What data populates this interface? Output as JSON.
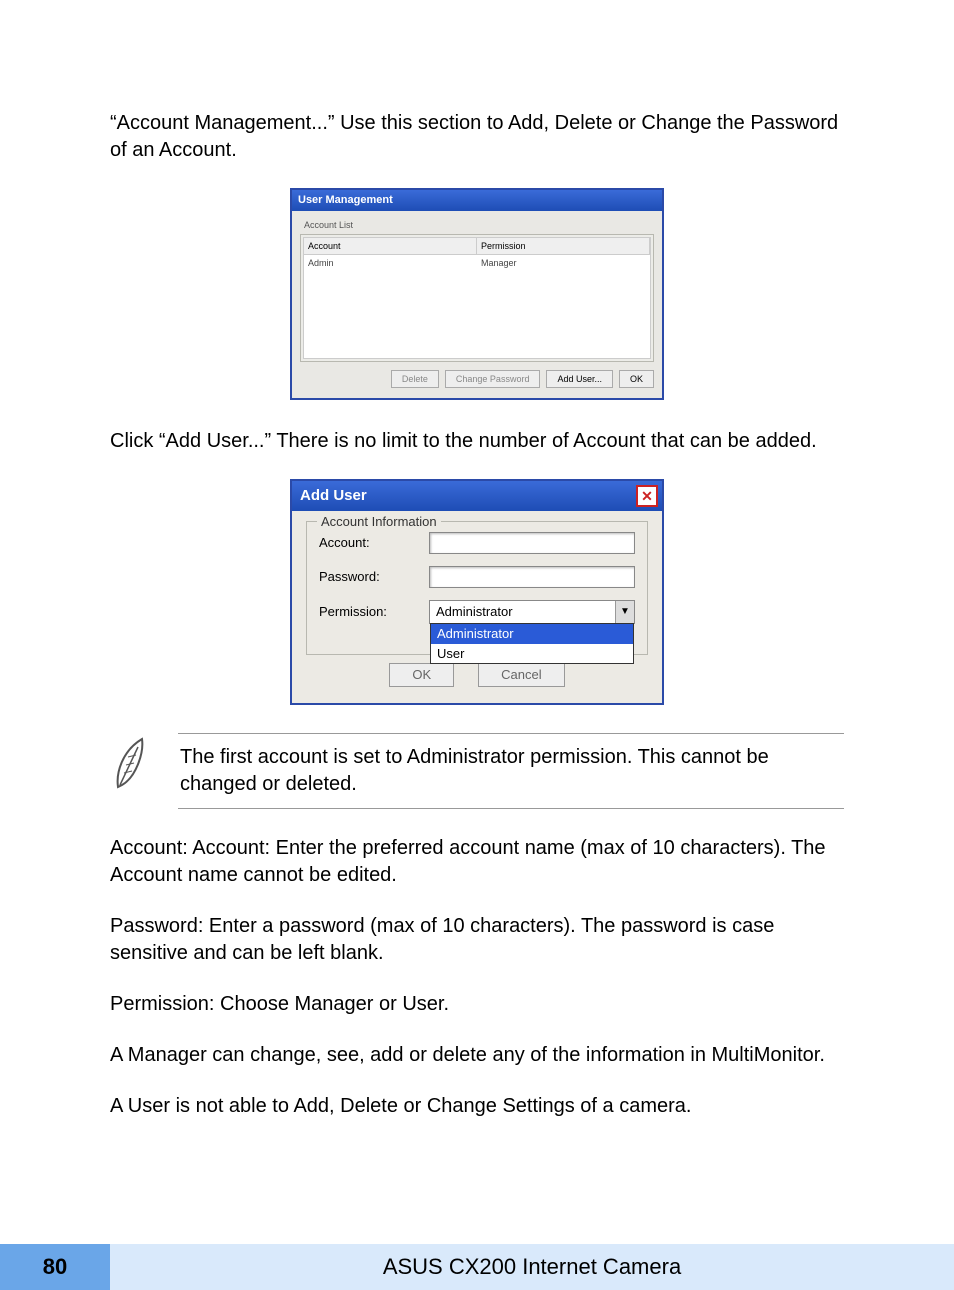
{
  "intro_para": "“Account Management...”  Use this section to Add, Delete or Change the Password of an Account.",
  "screenshot1": {
    "title": "User Management",
    "group_label": "Account List",
    "col1": "Account",
    "col2": "Permission",
    "row_account": "Admin",
    "row_permission": "Manager",
    "btn_delete": "Delete",
    "btn_change": "Change Password",
    "btn_add": "Add User...",
    "btn_ok": "OK"
  },
  "para2": "Click “Add User...”  There is no limit to the number of Account that can be added.",
  "screenshot2": {
    "title": "Add User",
    "group_label": "Account Information",
    "label_account": "Account:",
    "label_password": "Password:",
    "label_permission": "Permission:",
    "perm_selected": "Administrator",
    "perm_opt1": "Administrator",
    "perm_opt2": "User",
    "btn_ok": "OK",
    "btn_cancel": "Cancel"
  },
  "note": "The first account is set to Administrator permission.  This cannot be changed or deleted.",
  "para_account": "Account: Account: Enter the preferred account name (max of 10 characters). The Account name cannot be edited.",
  "para_password": "Password: Enter a password (max of 10 characters). The password is case sensitive and can be left blank.",
  "para_permission": "Permission: Choose Manager or User.",
  "para_manager": "A Manager can change, see, add or delete any of the information in MultiMonitor.",
  "para_user": "A User is not able to Add, Delete or Change Settings of a camera.",
  "footer": {
    "page_number": "80",
    "title": "ASUS CX200 Internet Camera"
  }
}
